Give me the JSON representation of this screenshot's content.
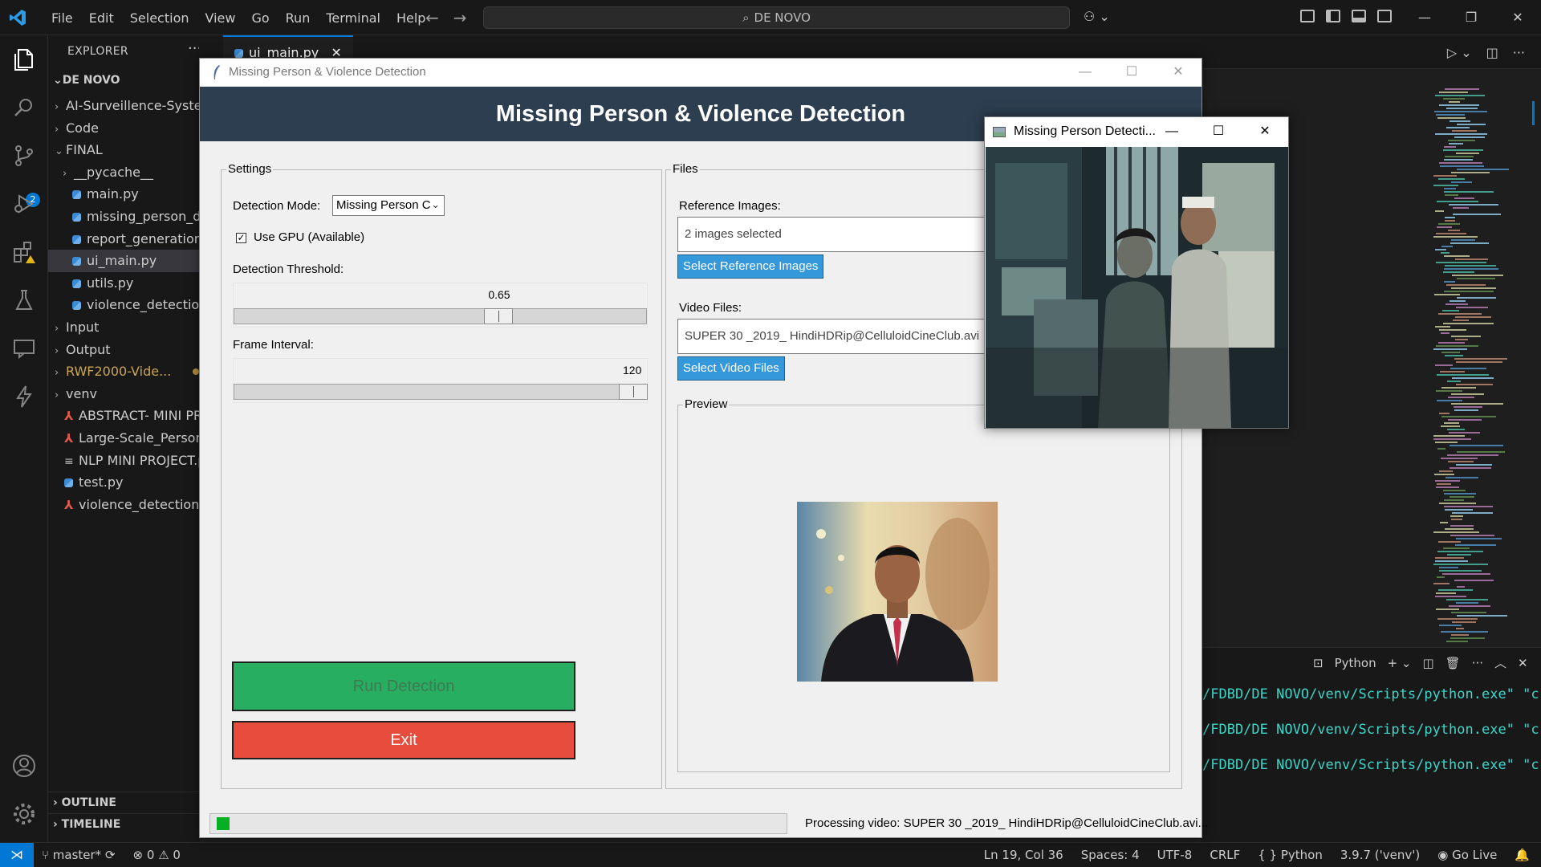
{
  "vscode": {
    "menu": [
      "File",
      "Edit",
      "Selection",
      "View",
      "Go",
      "Run",
      "Terminal",
      "Help"
    ],
    "command_center": "DE NOVO",
    "explorer": {
      "title": "EXPLORER",
      "root": "DE NOVO",
      "items": [
        {
          "label": "AI-Surveillence-Syste",
          "type": "folder",
          "indent": 1,
          "open": false
        },
        {
          "label": "Code",
          "type": "folder",
          "indent": 1,
          "open": false
        },
        {
          "label": "FINAL",
          "type": "folder",
          "indent": 1,
          "open": true
        },
        {
          "label": "__pycache__",
          "type": "folder",
          "indent": 2,
          "open": false
        },
        {
          "label": "main.py",
          "type": "py",
          "indent": 2
        },
        {
          "label": "missing_person_de",
          "type": "py",
          "indent": 2
        },
        {
          "label": "report_generation.p",
          "type": "py",
          "indent": 2
        },
        {
          "label": "ui_main.py",
          "type": "py",
          "indent": 2,
          "selected": true
        },
        {
          "label": "utils.py",
          "type": "py",
          "indent": 2
        },
        {
          "label": "violence_detection.",
          "type": "py",
          "indent": 2
        },
        {
          "label": "Input",
          "type": "folder",
          "indent": 1,
          "open": false
        },
        {
          "label": "Output",
          "type": "folder",
          "indent": 1,
          "open": false
        },
        {
          "label": "RWF2000-Vide...",
          "type": "folder",
          "indent": 1,
          "open": false,
          "modified": true
        },
        {
          "label": "venv",
          "type": "folder",
          "indent": 1,
          "open": false
        },
        {
          "label": "ABSTRACT- MINI PR",
          "type": "pdf",
          "indent": 1
        },
        {
          "label": "Large-Scale_Person_",
          "type": "pdf",
          "indent": 1
        },
        {
          "label": "NLP MINI PROJECT.p",
          "type": "txt",
          "indent": 1
        },
        {
          "label": "test.py",
          "type": "py",
          "indent": 1
        },
        {
          "label": "violence_detections.",
          "type": "pdf",
          "indent": 1
        }
      ],
      "outline": "OUTLINE",
      "timeline": "TIMELINE"
    },
    "tab": "ui_main.py",
    "scm_badge": "2",
    "panel": {
      "terminal_label": "Python",
      "lines": [
        "/FDBD/DE NOVO/venv/Scripts/python.exe\" \"c:/Us",
        "/FDBD/DE NOVO/venv/Scripts/python.exe\" \"c:/Us",
        "/FDBD/DE NOVO/venv/Scripts/python.exe\" \"c:/Us"
      ]
    },
    "status": {
      "branch": "master*",
      "errors": "0",
      "warnings": "0",
      "position": "Ln 19, Col 36",
      "spaces": "Spaces: 4",
      "encoding": "UTF-8",
      "eol": "CRLF",
      "language": "Python",
      "interpreter": "3.9.7 ('venv')",
      "golive": "Go Live"
    }
  },
  "app": {
    "window_title": "Missing Person & Violence Detection",
    "header": "Missing Person & Violence Detection",
    "settings": {
      "frame_label": "Settings",
      "mode_label": "Detection Mode:",
      "mode_value": "Missing Person C",
      "gpu_label": "Use GPU (Available)",
      "gpu_checked": true,
      "threshold_label": "Detection Threshold:",
      "threshold_value": "0.65",
      "threshold_fraction": 0.65,
      "interval_label": "Frame Interval:",
      "interval_value": "120",
      "interval_fraction": 1.0,
      "run_button": "Run Detection",
      "exit_button": "Exit"
    },
    "files": {
      "frame_label": "Files",
      "ref_label": "Reference Images:",
      "ref_value": "2 images selected",
      "ref_button": "Select Reference Images",
      "video_label": "Video Files:",
      "video_value": "SUPER 30 _2019_ HindiHDRip@CelluloidCineClub.avi",
      "video_button": "Select Video Files",
      "preview_label": "Preview"
    },
    "progress_fraction": 0.02,
    "status_text": "Processing video: SUPER 30 _2019_ HindiHDRip@CelluloidCineClub.avi..."
  },
  "video_window": {
    "title": "Missing Person Detecti..."
  },
  "colors": {
    "header_bg": "#2c3e50",
    "run_green": "#27ae60",
    "exit_red": "#e74c3c",
    "button_blue": "#3498db",
    "progress_green": "#06b025",
    "vscode_accent": "#0078d4"
  }
}
